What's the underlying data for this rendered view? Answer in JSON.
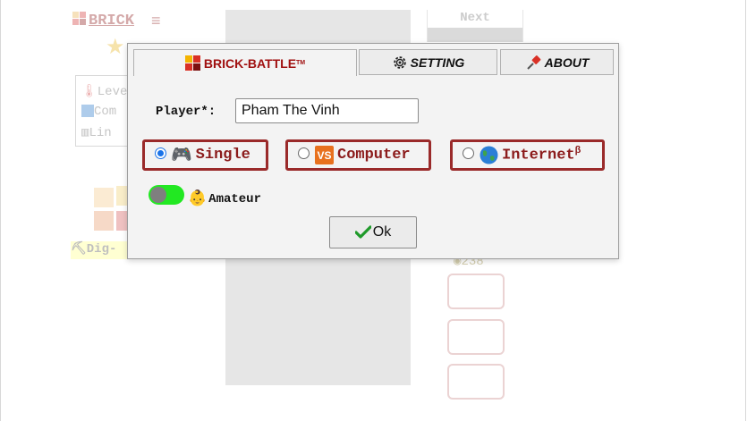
{
  "background": {
    "title": "BRICK",
    "menu_icon": "menu-icon",
    "info_rows": [
      "Leve",
      "Com",
      "Lin"
    ],
    "next_label": "Next",
    "dig_label": "Dig-",
    "coin_count": "238"
  },
  "dialog": {
    "tabs": [
      {
        "label": "BRICK-BATTLE",
        "trademark": "TM",
        "icon": "brick-logo-icon",
        "active": true
      },
      {
        "label": "SETTING",
        "icon": "gear-icon",
        "active": false
      },
      {
        "label": "ABOUT",
        "icon": "pin-icon",
        "active": false
      }
    ],
    "player_label": "Player*:",
    "player_value": "Pham The Vinh",
    "modes": [
      {
        "label": "Single",
        "icon": "gamepad-icon",
        "checked": true
      },
      {
        "label": "Computer",
        "icon": "vs-icon",
        "checked": false
      },
      {
        "label": "Internet",
        "superscript": "β",
        "icon": "globe-icon",
        "checked": false
      }
    ],
    "level_label": "Amateur",
    "level_toggle_on": true,
    "ok_label": "Ok"
  },
  "colors": {
    "brand_red": "#8c1c1c",
    "toggle_green": "#22e822",
    "radio_blue": "#1a73e8",
    "board_gray": "#bdbdbd"
  }
}
